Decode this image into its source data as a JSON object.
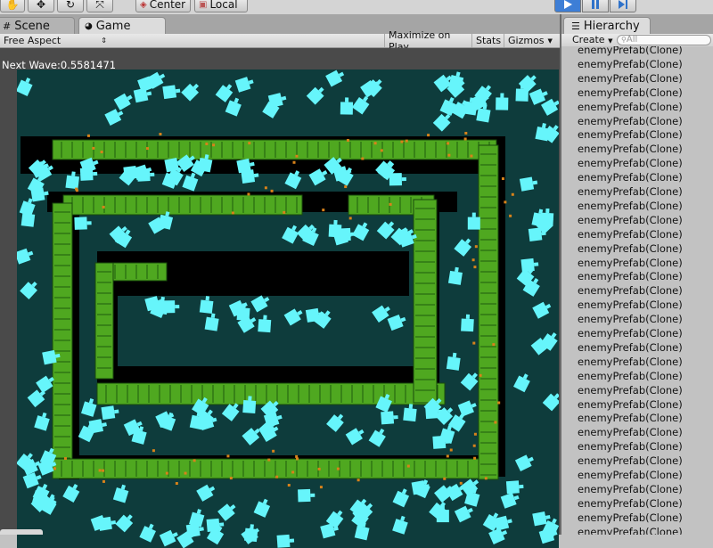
{
  "toolbar": {
    "pivot_label": "Center",
    "space_label": "Local",
    "icons": [
      "hand-icon",
      "move-icon",
      "rotate-icon",
      "scale-icon",
      "center-pivot-icon",
      "local-space-icon"
    ],
    "play_color": "#3d7ed6"
  },
  "tabs": {
    "scene": "Scene",
    "game": "Game",
    "hierarchy": "Hierarchy"
  },
  "game_toolbar": {
    "aspect": "Free Aspect",
    "maximize": "Maximize on Play",
    "stats": "Stats",
    "gizmos": "Gizmos"
  },
  "game_view": {
    "next_wave": "Next Wave:0.5581471",
    "colors": {
      "background": "#0e3c3c",
      "path": "#000000",
      "tower": "#4fa820",
      "enemy": "#66f5fb",
      "bullet": "#d8821a"
    }
  },
  "hierarchy": {
    "create_label": "Create",
    "search_placeholder": "All",
    "items": [
      "enemyPrefab(Clone)",
      "enemyPrefab(Clone)",
      "enemyPrefab(Clone)",
      "enemyPrefab(Clone)",
      "enemyPrefab(Clone)",
      "enemyPrefab(Clone)",
      "enemyPrefab(Clone)",
      "enemyPrefab(Clone)",
      "enemyPrefab(Clone)",
      "enemyPrefab(Clone)",
      "enemyPrefab(Clone)",
      "enemyPrefab(Clone)",
      "enemyPrefab(Clone)",
      "enemyPrefab(Clone)",
      "enemyPrefab(Clone)",
      "enemyPrefab(Clone)",
      "enemyPrefab(Clone)",
      "enemyPrefab(Clone)",
      "enemyPrefab(Clone)",
      "enemyPrefab(Clone)",
      "enemyPrefab(Clone)",
      "enemyPrefab(Clone)",
      "enemyPrefab(Clone)",
      "enemyPrefab(Clone)",
      "enemyPrefab(Clone)",
      "enemyPrefab(Clone)",
      "enemyPrefab(Clone)",
      "enemyPrefab(Clone)",
      "enemyPrefab(Clone)",
      "enemyPrefab(Clone)",
      "enemyPrefab(Clone)",
      "enemyPrefab(Clone)",
      "enemyPrefab(Clone)",
      "enemyPrefab(Clone)",
      "enemyPrefab(Clone)"
    ]
  }
}
